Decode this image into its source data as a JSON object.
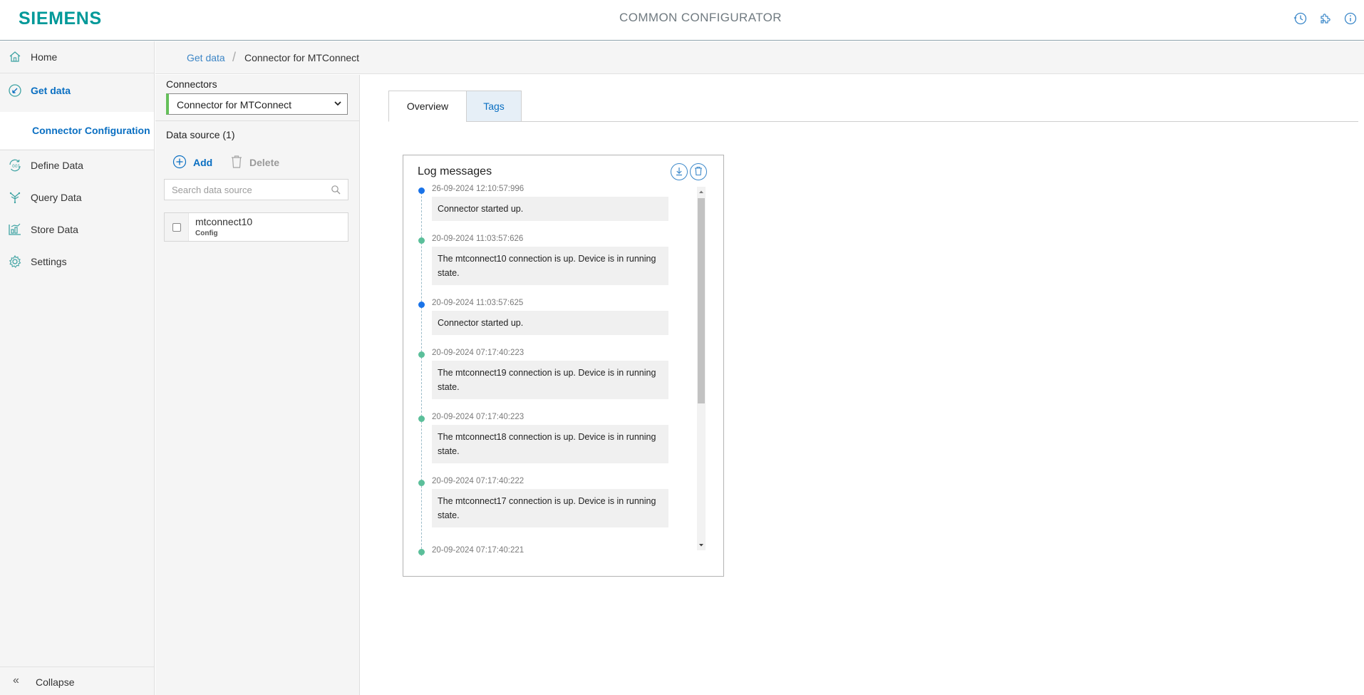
{
  "header": {
    "logo": "SIEMENS",
    "title": "COMMON CONFIGURATOR",
    "icons": [
      "clock-icon",
      "puzzle-icon",
      "info-icon"
    ]
  },
  "nav": {
    "items": [
      {
        "label": "Home",
        "icon": "home-icon"
      },
      {
        "label": "Get data",
        "icon": "get-data-icon"
      },
      {
        "label": "Define Data",
        "icon": "define-data-icon"
      },
      {
        "label": "Query Data",
        "icon": "query-data-icon"
      },
      {
        "label": "Store Data",
        "icon": "store-data-icon"
      },
      {
        "label": "Settings",
        "icon": "gear-icon"
      }
    ],
    "subitem": "Connector Configuration",
    "collapse": "Collapse"
  },
  "breadcrumb": {
    "parent": "Get data",
    "current": "Connector for MTConnect"
  },
  "connectors": {
    "label": "Connectors",
    "selected": "Connector for MTConnect"
  },
  "datasource": {
    "title": "Data source (1)",
    "add": "Add",
    "delete": "Delete",
    "search_placeholder": "Search data source",
    "items": [
      {
        "name": "mtconnect10",
        "sub": "Config"
      }
    ]
  },
  "tabs": [
    "Overview",
    "Tags"
  ],
  "log": {
    "title": "Log messages",
    "entries": [
      {
        "time": "26-09-2024 12:10:57:996",
        "message": "Connector started up.",
        "status": "info"
      },
      {
        "time": "20-09-2024 11:03:57:626",
        "message": "The mtconnect10 connection is up. Device is in running state.",
        "status": "success"
      },
      {
        "time": "20-09-2024 11:03:57:625",
        "message": "Connector started up.",
        "status": "info"
      },
      {
        "time": "20-09-2024 07:17:40:223",
        "message": "The mtconnect19 connection is up. Device is in running state.",
        "status": "success"
      },
      {
        "time": "20-09-2024 07:17:40:223",
        "message": "The mtconnect18 connection is up. Device is in running state.",
        "status": "success"
      },
      {
        "time": "20-09-2024 07:17:40:222",
        "message": "The mtconnect17 connection is up. Device is in running state.",
        "status": "success"
      },
      {
        "time": "20-09-2024 07:17:40:221",
        "message": "",
        "status": "success"
      }
    ]
  },
  "colors": {
    "brand": "#009999",
    "accent": "#0a6fc2",
    "info_dot": "#1a73e8",
    "success_dot": "#5bbf9a",
    "select_bar": "#65c05a"
  }
}
